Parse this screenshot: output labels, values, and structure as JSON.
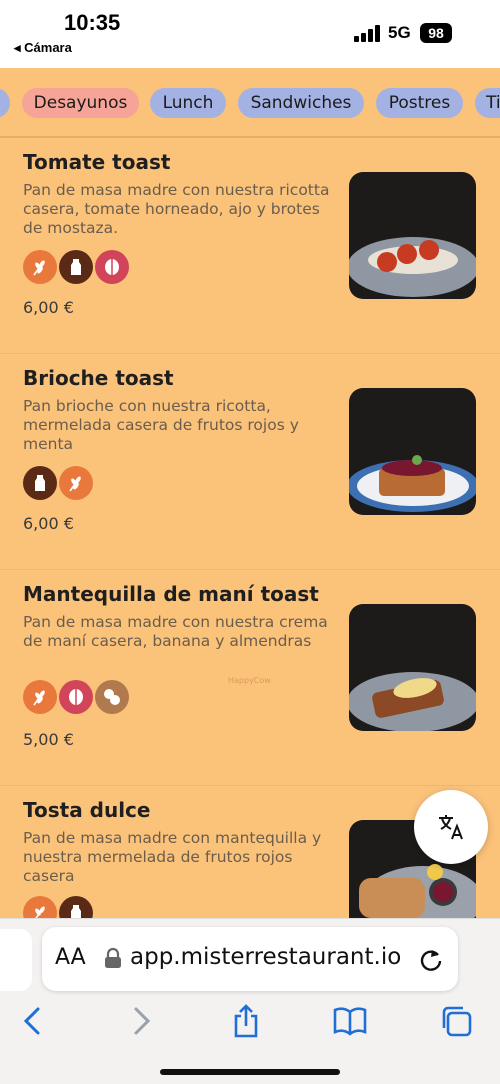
{
  "status_bar": {
    "time": "10:35",
    "back_app": "◂ Cámara",
    "network": "5G",
    "battery": "98"
  },
  "tabs": [
    {
      "label": ""
    },
    {
      "label": "Desayunos",
      "active": true
    },
    {
      "label": "Lunch"
    },
    {
      "label": "Sandwiches"
    },
    {
      "label": "Postres"
    },
    {
      "label": "Ti"
    }
  ],
  "menu_items": [
    {
      "title": "Tomate toast",
      "description": "Pan de masa madre con nuestra ricotta casera, tomate horneado, ajo y brotes de mostaza.",
      "badges": [
        "wheat-icon",
        "milk-icon",
        "nut-icon"
      ],
      "price": "6,00 €"
    },
    {
      "title": "Brioche toast",
      "description": "Pan brioche con nuestra ricotta, mermelada casera de frutos rojos y menta",
      "badges": [
        "milk-icon",
        "wheat-icon"
      ],
      "price": "6,00 €"
    },
    {
      "title": "Mantequilla de maní toast",
      "description": "Pan de masa madre con nuestra crema de maní casera, banana y almendras",
      "badges": [
        "wheat-icon",
        "nut-icon",
        "peanut-icon"
      ],
      "price": "5,00 €"
    },
    {
      "title": "Tosta dulce",
      "description": "Pan de masa madre con mantequilla y nuestra mermelada de frutos rojos casera",
      "badges": [
        "wheat-icon",
        "milk-icon"
      ],
      "price": ""
    }
  ],
  "watermark": "HappyCow",
  "browser": {
    "aa_label": "AA",
    "url": "app.misterrestaurant.io"
  },
  "colors": {
    "background": "#fbc27a",
    "tab": "#a3b1e3",
    "tab_active": "#f5a497",
    "safari_blue": "#1f6fd6"
  }
}
